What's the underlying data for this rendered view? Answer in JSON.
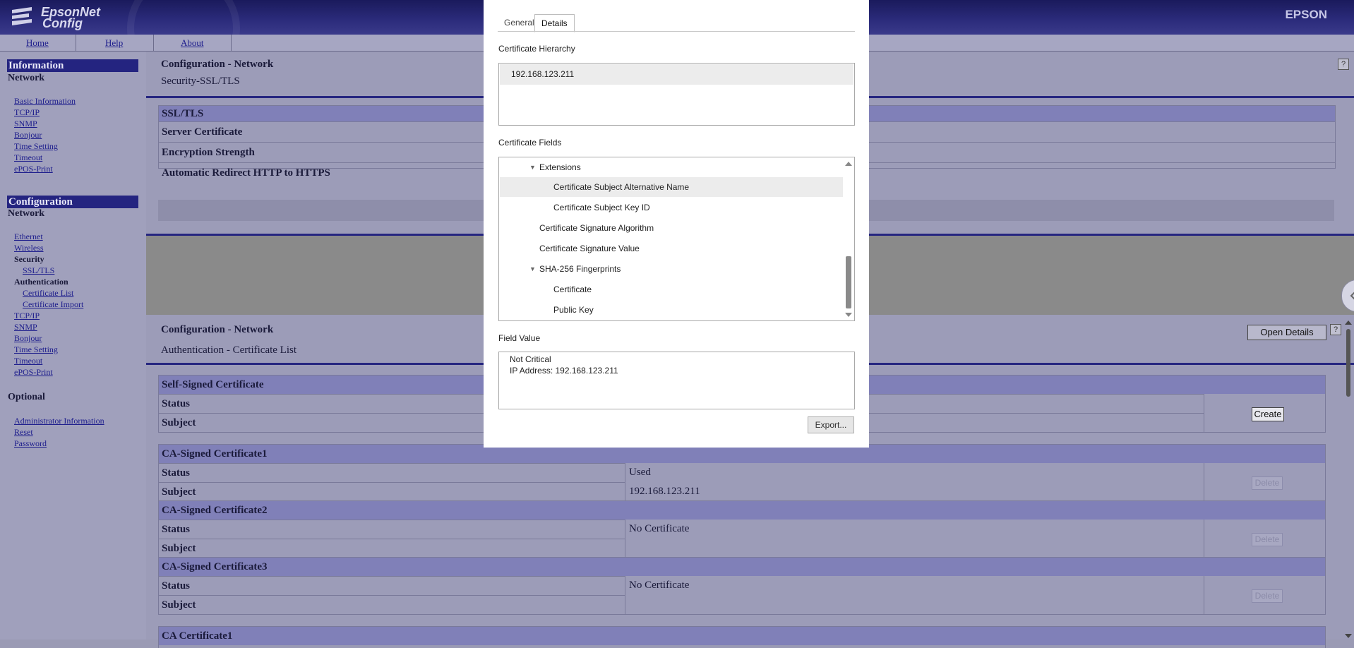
{
  "header": {
    "logo_line1": "EpsonNet",
    "logo_line2": "Config",
    "brand": "EPSON"
  },
  "nav": {
    "home": "Home",
    "help": "Help",
    "about": "About"
  },
  "sidebar": {
    "information": "Information",
    "info_network": "Network",
    "info_links": [
      "Basic Information",
      "TCP/IP",
      "SNMP",
      "Bonjour",
      "Time Setting",
      "Timeout",
      "ePOS-Print"
    ],
    "configuration": "Configuration",
    "config_network": "Network",
    "config_links_top": [
      "Ethernet",
      "Wireless"
    ],
    "security": "Security",
    "ssl_tls": "SSL/TLS",
    "authentication": "Authentication",
    "auth_links": [
      "Certificate List",
      "Certificate Import"
    ],
    "config_links_bottom": [
      "TCP/IP",
      "SNMP",
      "Bonjour",
      "Time Setting",
      "Timeout",
      "ePOS-Print"
    ],
    "optional": "Optional",
    "optional_links": [
      "Administrator Information",
      "Reset",
      "Password"
    ]
  },
  "section1": {
    "title": "Configuration - Network",
    "subtitle": "Security-SSL/TLS",
    "header": "SSL/TLS",
    "rows": [
      "Server Certificate",
      "Encryption Strength",
      "Automatic Redirect HTTP to HTTPS"
    ]
  },
  "section2": {
    "title": "Configuration - Network",
    "subtitle": "Authentication - Certificate List",
    "open_details": "Open Details",
    "help": "?",
    "self_signed": {
      "header": "Self-Signed Certificate",
      "status_label": "Status",
      "subject_label": "Subject",
      "button": "Create"
    },
    "ca1": {
      "header": "CA-Signed Certificate1",
      "status_label": "Status",
      "status": "Used",
      "subject_label": "Subject",
      "subject": "192.168.123.211",
      "button": "Delete"
    },
    "ca2": {
      "header": "CA-Signed Certificate2",
      "status_label": "Status",
      "status": "No Certificate",
      "subject_label": "Subject",
      "subject": "",
      "button": "Delete"
    },
    "ca3": {
      "header": "CA-Signed Certificate3",
      "status_label": "Status",
      "status": "No Certificate",
      "subject_label": "Subject",
      "subject": "",
      "button": "Delete"
    },
    "ca_cert1": {
      "header": "CA Certificate1"
    }
  },
  "dialog": {
    "tabs": [
      "General",
      "Details"
    ],
    "active_tab": "Details",
    "hierarchy_label": "Certificate Hierarchy",
    "hierarchy_item": "192.168.123.211",
    "fields_label": "Certificate Fields",
    "fields": [
      {
        "label": "Extensions",
        "expanded": true,
        "selected": false
      },
      {
        "label": "Certificate Subject Alternative Name",
        "selected": true
      },
      {
        "label": "Certificate Subject Key ID",
        "selected": false
      },
      {
        "label": "Certificate Signature Algorithm",
        "selected": false
      },
      {
        "label": "Certificate Signature Value",
        "selected": false
      },
      {
        "label": "SHA-256 Fingerprints",
        "expanded": true,
        "selected": false
      },
      {
        "label": "Certificate",
        "selected": false
      },
      {
        "label": "Public Key",
        "selected": false
      }
    ],
    "value_label": "Field Value",
    "value_lines": [
      "Not Critical",
      "IP Address: 192.168.123.211"
    ],
    "export_button": "Export..."
  }
}
